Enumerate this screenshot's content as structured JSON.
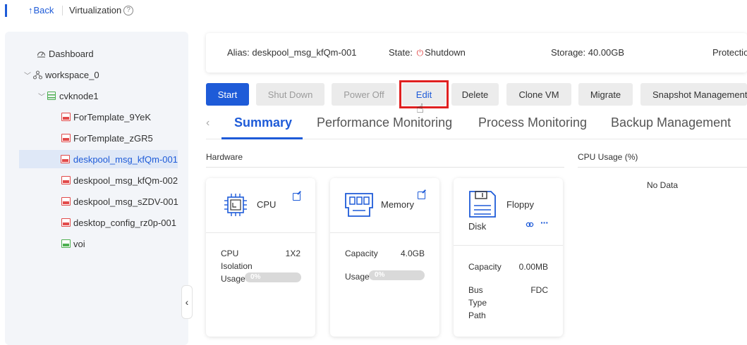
{
  "header": {
    "back_label": "Back",
    "breadcrumb": "Virtualization"
  },
  "sidebar": {
    "items": [
      {
        "label": "Dashboard",
        "icon": "dashboard-icon"
      },
      {
        "label": "workspace_0",
        "icon": "workspace-icon"
      },
      {
        "label": "cvknode1",
        "icon": "host-icon"
      },
      {
        "label": "ForTemplate_9YeK",
        "icon": "vm-icon",
        "status": "stopped"
      },
      {
        "label": "ForTemplate_zGR5",
        "icon": "vm-icon",
        "status": "stopped"
      },
      {
        "label": "deskpool_msg_kfQm-001",
        "icon": "vm-icon",
        "status": "stopped",
        "selected": true
      },
      {
        "label": "deskpool_msg_kfQm-002",
        "icon": "vm-icon",
        "status": "stopped"
      },
      {
        "label": "deskpool_msg_sZDV-001",
        "icon": "vm-icon",
        "status": "stopped"
      },
      {
        "label": "desktop_config_rz0p-001",
        "icon": "vm-icon",
        "status": "stopped"
      },
      {
        "label": "voi",
        "icon": "vm-icon",
        "status": "running"
      }
    ]
  },
  "info": {
    "alias": "Alias: deskpool_msg_kfQm-001",
    "state_label": "State:",
    "state_value": "Shutdown",
    "storage": "Storage: 40.00GB",
    "protection": "Protection"
  },
  "toolbar": {
    "start": "Start",
    "shutdown": "Shut Down",
    "poweroff": "Power Off",
    "edit": "Edit",
    "delete": "Delete",
    "clone": "Clone VM",
    "migrate": "Migrate",
    "snapshot": "Snapshot Management"
  },
  "tabs": [
    "Summary",
    "Performance Monitoring",
    "Process Monitoring",
    "Backup Management"
  ],
  "hardware": {
    "title": "Hardware",
    "cpu": {
      "name": "CPU",
      "rows": [
        {
          "label": "CPU",
          "value": "1X2"
        },
        {
          "label": "Isolation",
          "value": ""
        },
        {
          "label": "Usage",
          "value": "0%"
        }
      ],
      "usage_fraction": 0
    },
    "memory": {
      "name": "Memory",
      "rows": [
        {
          "label": "Capacity",
          "value": "4.0GB"
        },
        {
          "label": "Usage",
          "value": "0%"
        }
      ],
      "usage_fraction": 0
    },
    "floppy": {
      "name_line1": "Floppy",
      "name_line2": "Disk",
      "rows": [
        {
          "label": "Capacity",
          "value": "0.00MB"
        },
        {
          "label": "Bus",
          "value": "FDC"
        },
        {
          "label": "Type",
          "value": ""
        },
        {
          "label": "Path",
          "value": ""
        }
      ]
    }
  },
  "cpu_usage": {
    "title": "CPU Usage (%)",
    "empty_text": "No Data"
  },
  "colors": {
    "accent": "#1e5bd8",
    "danger": "#e24a4a",
    "highlight": "#e02020",
    "running": "#4caf50"
  }
}
